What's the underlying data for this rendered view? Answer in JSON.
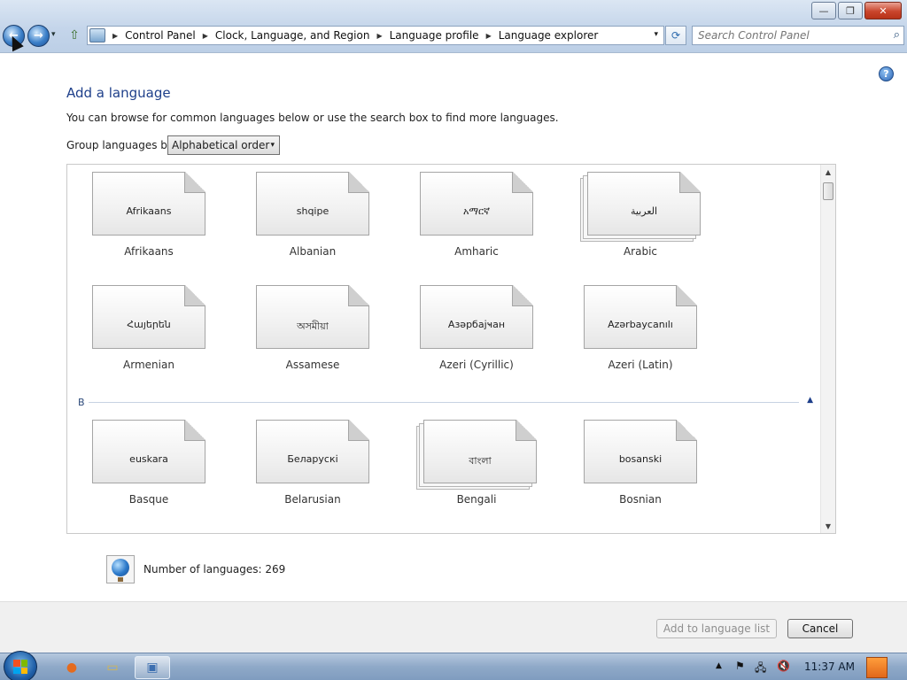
{
  "window": {
    "minimize_glyph": "—",
    "maximize_glyph": "❐",
    "close_glyph": "✕"
  },
  "nav": {
    "back_glyph": "←",
    "forward_glyph": "→",
    "recent_glyph": "▾",
    "up_glyph": "⇧",
    "breadcrumbs": [
      "Control Panel",
      "Clock, Language, and Region",
      "Language profile",
      "Language explorer"
    ],
    "breadcrumb_separator": "▶",
    "address_dropdown_glyph": "▾",
    "refresh_glyph": "⟳",
    "search_placeholder": "Search Control Panel",
    "search_glyph": "⌕"
  },
  "help_glyph": "?",
  "page": {
    "title": "Add a language",
    "description": "You can browse for common languages below or use the search box to find more languages.",
    "group_label": "Group languages by:",
    "group_value": "Alphabetical order",
    "group_dropdown_glyph": "▾"
  },
  "languages": {
    "section_letter": "B",
    "section_chevron": "▲",
    "scroll_up_glyph": "▲",
    "scroll_down_glyph": "▼",
    "items": [
      {
        "native": "Afrikaans",
        "name": "Afrikaans",
        "stacked": false
      },
      {
        "native": "shqipe",
        "name": "Albanian",
        "stacked": false
      },
      {
        "native": "አማርኛ",
        "name": "Amharic",
        "stacked": false
      },
      {
        "native": "العربية",
        "name": "Arabic",
        "stacked": true
      },
      {
        "native": "Հայերեն",
        "name": "Armenian",
        "stacked": false
      },
      {
        "native": "অসমীয়া",
        "name": "Assamese",
        "stacked": false
      },
      {
        "native": "Азәрбајҹан",
        "name": "Azeri (Cyrillic)",
        "stacked": false
      },
      {
        "native": "Azərbaycanılı",
        "name": "Azeri (Latin)",
        "stacked": false
      },
      {
        "native": "euskara",
        "name": "Basque",
        "stacked": false
      },
      {
        "native": "Беларускі",
        "name": "Belarusian",
        "stacked": false
      },
      {
        "native": "বাংলা",
        "name": "Bengali",
        "stacked": true
      },
      {
        "native": "bosanski",
        "name": "Bosnian",
        "stacked": false
      }
    ]
  },
  "count_text": "Number of languages: 269",
  "buttons": {
    "add": "Add to language list",
    "cancel": "Cancel"
  },
  "taskbar": {
    "items": [
      {
        "name": "firefox-taskbar-icon",
        "glyph": "●",
        "color": "#e46b1e",
        "active": false
      },
      {
        "name": "explorer-taskbar-icon",
        "glyph": "▭",
        "color": "#d8b64a",
        "active": false
      },
      {
        "name": "control-panel-taskbar-icon",
        "glyph": "▣",
        "color": "#3c6fb0",
        "active": true
      }
    ],
    "tray": {
      "show_hidden_glyph": "▲",
      "flag_glyph": "⚑",
      "network_glyph": "🖧",
      "volume_glyph": "🔇"
    },
    "clock": "11:37 AM"
  },
  "colors": {
    "title_blue": "#1e3f8a",
    "start_orb": "#1f5fa8"
  }
}
